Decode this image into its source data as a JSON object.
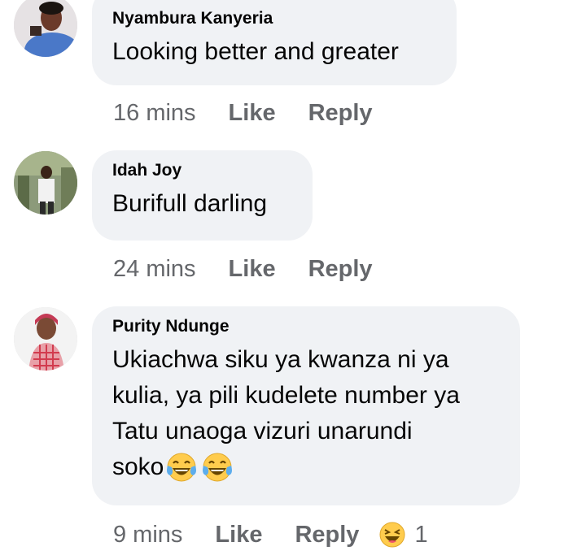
{
  "comments": [
    {
      "author": "Nyambura Kanyeria",
      "text": "Looking better and greater",
      "time": "16 mins",
      "like_label": "Like",
      "reply_label": "Reply"
    },
    {
      "author": "Idah Joy",
      "text": "Burifull darling",
      "time": "24 mins",
      "like_label": "Like",
      "reply_label": "Reply"
    },
    {
      "author": "Purity Ndunge",
      "text_lines": [
        "Ukiachwa siku ya kwanza ni ya",
        "kulia, ya pili kudelete number ya",
        "Tatu unaoga vizuri unarundi",
        "soko"
      ],
      "text_emojis": [
        "laughing-tears-emoji",
        "laughing-tears-emoji"
      ],
      "time": "9 mins",
      "like_label": "Like",
      "reply_label": "Reply",
      "reaction": {
        "icon": "haha-reaction-icon",
        "count": "1"
      }
    }
  ],
  "colors": {
    "bubble": "#f0f2f5",
    "text": "#050505",
    "meta": "#65676b",
    "emoji_yellow": "#ffcc4d",
    "tears": "#5dadec"
  }
}
